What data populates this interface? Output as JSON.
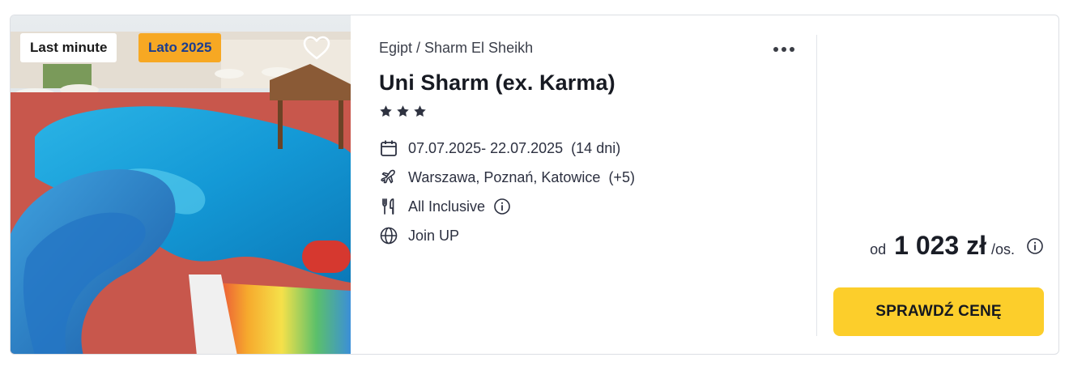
{
  "offer": {
    "badges": [
      "Last minute",
      "Lato 2025"
    ],
    "location": "Egipt / Sharm El Sheikh",
    "hotel_name": "Uni Sharm (ex. Karma)",
    "stars": 3,
    "dates": "07.07.2025- 22.07.2025",
    "duration": "(14 dni)",
    "airports": "Warszawa, Poznań, Katowice",
    "airports_more": "(+5)",
    "board": "All Inclusive",
    "operator": "Join UP"
  },
  "price": {
    "prefix": "od",
    "value": "1 023 zł",
    "unit": "/os."
  },
  "cta": {
    "label": "SPRAWDŹ CENĘ"
  },
  "colors": {
    "accent": "#fcce2b",
    "season_badge_bg": "#f7a823",
    "season_badge_text": "#1b3d8f"
  },
  "icons": {
    "favorite": "heart-icon",
    "more": "more-dots-icon",
    "star": "star-icon",
    "dates": "calendar-icon",
    "airports": "plane-icon",
    "board": "cutlery-icon",
    "operator": "globe-icon",
    "info": "info-icon"
  }
}
